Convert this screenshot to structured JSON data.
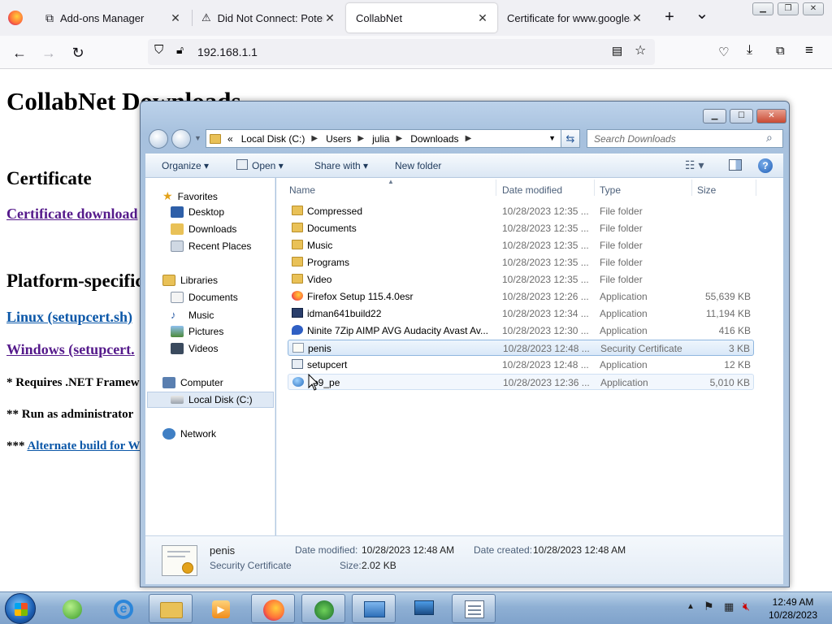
{
  "browser": {
    "tabs": [
      {
        "label": "Add-ons Manager"
      },
      {
        "label": "Did Not Connect: Potential"
      },
      {
        "label": "CollabNet"
      },
      {
        "label": "Certificate for www.googleads"
      }
    ],
    "url": "192.168.1.1",
    "new_tab": "+",
    "tab_list": "⌄"
  },
  "webpage": {
    "title": "CollabNet Downloads",
    "certificate_heading": "Certificate",
    "certificate_link": "Certificate download",
    "platform_heading": "Platform-specific",
    "linux_link": "Linux (setupcert.sh)",
    "windows_link": "Windows (setupcert.",
    "note1": "* Requires .NET Framework",
    "note2": "** Run as administrator",
    "note3_prefix": "***",
    "note3_link": "Alternate build for W"
  },
  "explorer": {
    "breadcrumb": [
      "«",
      "Local Disk (C:)",
      "Users",
      "julia",
      "Downloads"
    ],
    "search_placeholder": "Search Downloads",
    "commands": {
      "organize": "Organize",
      "open": "Open",
      "share": "Share with",
      "new_folder": "New folder"
    },
    "nav": {
      "favorites": "Favorites",
      "desktop": "Desktop",
      "downloads": "Downloads",
      "recent": "Recent Places",
      "libraries": "Libraries",
      "documents": "Documents",
      "music": "Music",
      "pictures": "Pictures",
      "videos": "Videos",
      "computer": "Computer",
      "local_disk": "Local Disk (C:)",
      "network": "Network"
    },
    "columns": {
      "name": "Name",
      "date": "Date modified",
      "type": "Type",
      "size": "Size"
    },
    "files": [
      {
        "name": "Compressed",
        "date": "10/28/2023 12:35 ...",
        "type": "File folder",
        "size": "",
        "icon": "folder-icon"
      },
      {
        "name": "Documents",
        "date": "10/28/2023 12:35 ...",
        "type": "File folder",
        "size": "",
        "icon": "folder-icon"
      },
      {
        "name": "Music",
        "date": "10/28/2023 12:35 ...",
        "type": "File folder",
        "size": "",
        "icon": "folder-icon"
      },
      {
        "name": "Programs",
        "date": "10/28/2023 12:35 ...",
        "type": "File folder",
        "size": "",
        "icon": "folder-icon"
      },
      {
        "name": "Video",
        "date": "10/28/2023 12:35 ...",
        "type": "File folder",
        "size": "",
        "icon": "folder-icon"
      },
      {
        "name": "Firefox Setup 115.4.0esr",
        "date": "10/28/2023 12:26 ...",
        "type": "Application",
        "size": "55,639 KB",
        "icon": "firefox-installer-icon"
      },
      {
        "name": "idman641build22",
        "date": "10/28/2023 12:34 ...",
        "type": "Application",
        "size": "11,194 KB",
        "icon": "idm-installer-icon"
      },
      {
        "name": "Ninite 7Zip AIMP AVG Audacity Avast Av...",
        "date": "10/28/2023 12:30 ...",
        "type": "Application",
        "size": "416 KB",
        "icon": "ninite-icon"
      },
      {
        "name": "penis",
        "date": "10/28/2023 12:48 ...",
        "type": "Security Certificate",
        "size": "3 KB",
        "icon": "certificate-icon"
      },
      {
        "name": "setupcert",
        "date": "10/28/2023 12:48 ...",
        "type": "Application",
        "size": "12 KB",
        "icon": "application-icon"
      },
      {
        "name": "so9_pe",
        "date": "10/28/2023 12:36 ...",
        "type": "Application",
        "size": "5,010 KB",
        "icon": "globe-app-icon"
      }
    ],
    "details": {
      "name": "penis",
      "type": "Security Certificate",
      "date_modified_label": "Date modified:",
      "date_modified": "10/28/2023 12:48 AM",
      "date_created_label": "Date created:",
      "date_created": "10/28/2023 12:48 AM",
      "size_label": "Size:",
      "size": "2.02 KB"
    }
  },
  "taskbar": {
    "time": "12:49 AM",
    "date": "10/28/2023"
  },
  "colors": {
    "link_visited": "#551a8b",
    "link": "#0b57a8",
    "selection_border": "#8fb6df"
  }
}
